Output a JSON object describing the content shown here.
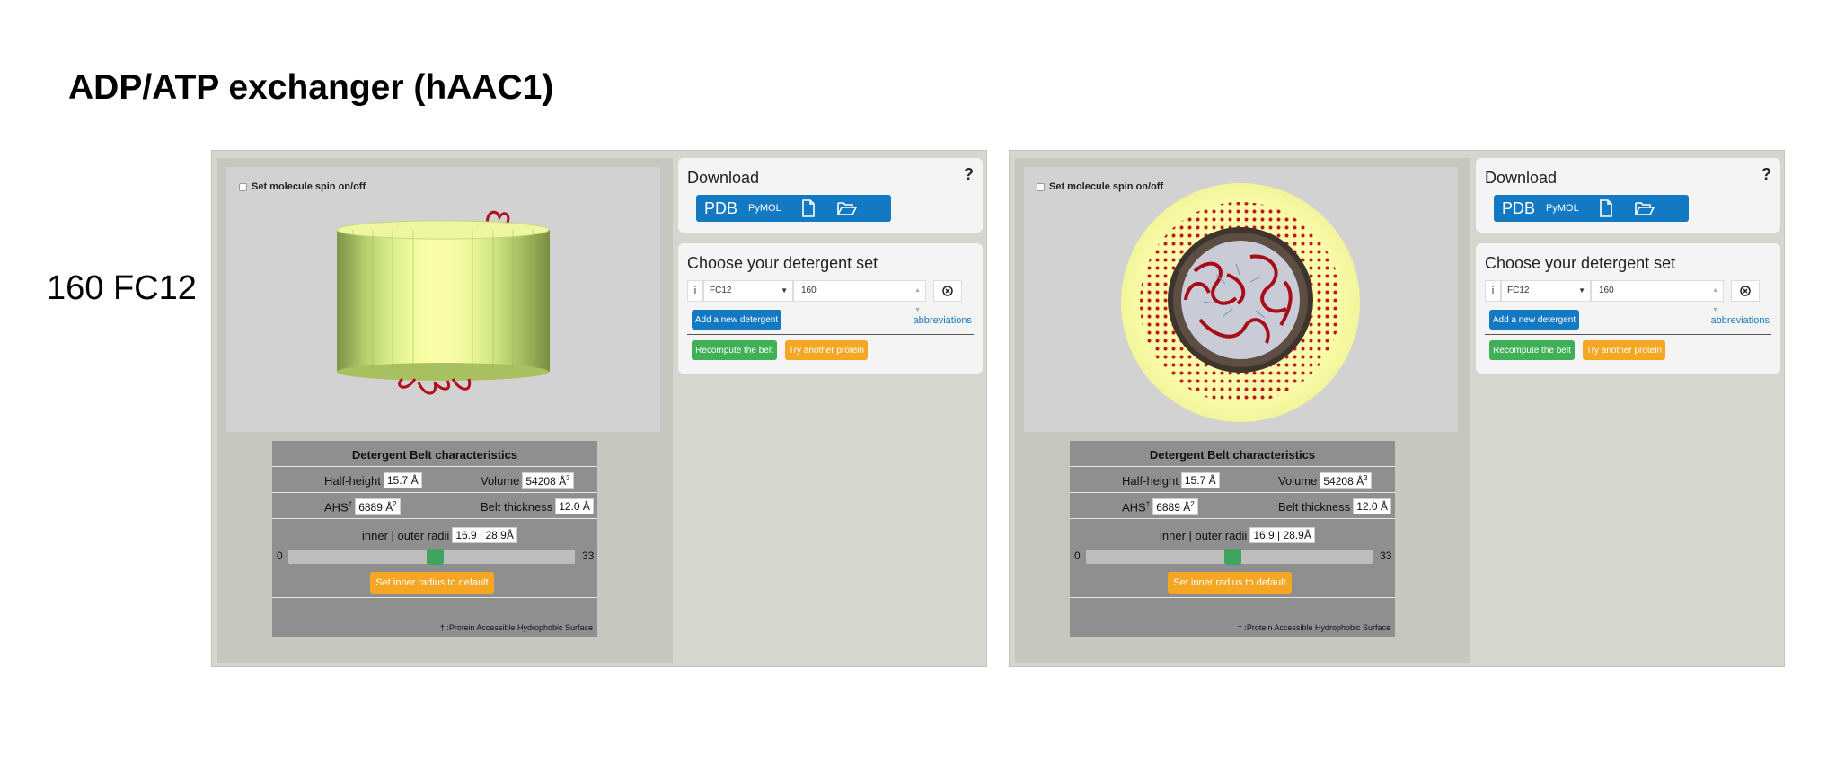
{
  "title": "ADP/ATP exchanger (hAAC1)",
  "row_label": "160 FC12",
  "panels": [
    {
      "view": "side",
      "spin_label": "Set molecule spin on/off",
      "download": {
        "title": "Download",
        "help": "?",
        "pdb": "PDB",
        "pymol": "PyMOL",
        "file_icon": "file-icon",
        "folder_icon": "folder-open-icon"
      },
      "detergent": {
        "title": "Choose your detergent set",
        "info": "i",
        "selected_detergent": "FC12",
        "count": "160",
        "add_label": "Add a new detergent",
        "abbreviations": "abbreviations",
        "recompute_label": "Recompute the belt",
        "try_label": "Try another protein"
      },
      "belt": {
        "title": "Detergent Belt characteristics",
        "half_height_label": "Half-height",
        "half_height": "15.7 Å",
        "volume_label": "Volume",
        "volume": "54208 Å",
        "ahs_label": "AHS",
        "ahs": "6889 Å",
        "thickness_label": "Belt thickness",
        "thickness": "12.0 Å",
        "radii_label": "inner | outer radii",
        "radii": "16.9 | 28.9Å",
        "slider_min": "0",
        "slider_max": "33",
        "slider_value": 16.9,
        "default_label": "Set inner radius to default",
        "footnote": "† :Protein Accessible Hydrophobic Surface"
      }
    },
    {
      "view": "top",
      "spin_label": "Set molecule spin on/off",
      "download": {
        "title": "Download",
        "help": "?",
        "pdb": "PDB",
        "pymol": "PyMOL",
        "file_icon": "file-icon",
        "folder_icon": "folder-open-icon"
      },
      "detergent": {
        "title": "Choose your detergent set",
        "info": "i",
        "selected_detergent": "FC12",
        "count": "160",
        "add_label": "Add a new detergent",
        "abbreviations": "abbreviations",
        "recompute_label": "Recompute the belt",
        "try_label": "Try another protein"
      },
      "belt": {
        "title": "Detergent Belt characteristics",
        "half_height_label": "Half-height",
        "half_height": "15.7 Å",
        "volume_label": "Volume",
        "volume": "54208 Å",
        "ahs_label": "AHS",
        "ahs": "6889 Å",
        "thickness_label": "Belt thickness",
        "thickness": "12.0 Å",
        "radii_label": "inner | outer radii",
        "radii": "16.9 | 28.9Å",
        "slider_min": "0",
        "slider_max": "33",
        "slider_value": 16.9,
        "default_label": "Set inner radius to default",
        "footnote": "† :Protein Accessible Hydrophobic Surface"
      }
    }
  ],
  "colors": {
    "primary_blue": "#1479c3",
    "success_green": "#3fb055",
    "warning_orange": "#f5a623",
    "belt_yellow": "#fdfda8",
    "protein_red": "#b0101c"
  }
}
